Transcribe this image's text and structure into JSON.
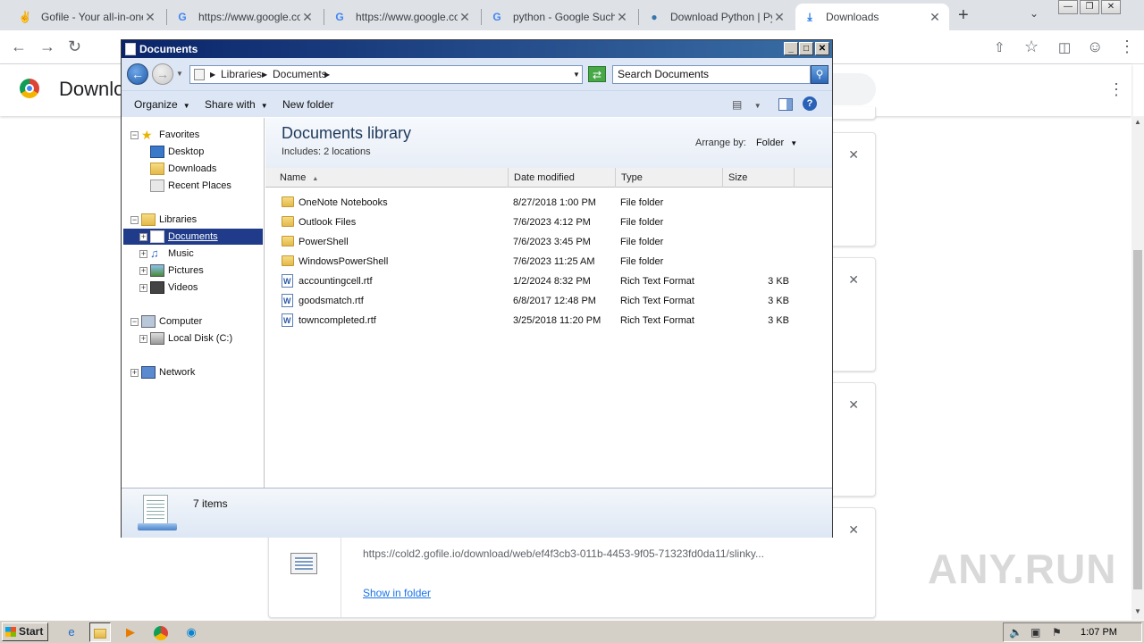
{
  "browser": {
    "tabs": [
      {
        "title": "Gofile - Your all-in-one",
        "icon": "gofile-icon"
      },
      {
        "title": "https://www.google.co",
        "icon": "google-icon"
      },
      {
        "title": "https://www.google.co",
        "icon": "google-icon"
      },
      {
        "title": "python - Google Suche",
        "icon": "google-icon"
      },
      {
        "title": "Download Python | Pyt",
        "icon": "python-icon"
      },
      {
        "title": "Downloads",
        "icon": "download-icon",
        "active": true
      }
    ]
  },
  "downloads_page": {
    "title": "Downloads",
    "card": {
      "url": "https://cold2.gofile.io/download/web/ef4f3cb3-011b-4453-9f05-71323fd0da11/slinky...",
      "show_in_folder": "Show in folder"
    }
  },
  "explorer": {
    "title": "Documents",
    "address": {
      "segments": [
        "Libraries",
        "Documents"
      ]
    },
    "search_placeholder": "Search Documents",
    "commands": {
      "organize": "Organize",
      "share_with": "Share with",
      "new_folder": "New folder"
    },
    "nav": {
      "favorites": "Favorites",
      "desktop": "Desktop",
      "downloads": "Downloads",
      "recent_places": "Recent Places",
      "libraries": "Libraries",
      "documents": "Documents",
      "music": "Music",
      "pictures": "Pictures",
      "videos": "Videos",
      "computer": "Computer",
      "local_disk": "Local Disk (C:)",
      "network": "Network"
    },
    "library": {
      "title": "Documents library",
      "includes": "Includes:  2 locations",
      "arrange_by_label": "Arrange by:",
      "arrange_by_value": "Folder"
    },
    "columns": {
      "name": "Name",
      "date": "Date modified",
      "type": "Type",
      "size": "Size"
    },
    "files": [
      {
        "name": "OneNote Notebooks",
        "date": "8/27/2018 1:00 PM",
        "type": "File folder",
        "size": "",
        "kind": "folder"
      },
      {
        "name": "Outlook Files",
        "date": "7/6/2023 4:12 PM",
        "type": "File folder",
        "size": "",
        "kind": "folder"
      },
      {
        "name": "PowerShell",
        "date": "7/6/2023 3:45 PM",
        "type": "File folder",
        "size": "",
        "kind": "folder"
      },
      {
        "name": "WindowsPowerShell",
        "date": "7/6/2023 11:25 AM",
        "type": "File folder",
        "size": "",
        "kind": "folder"
      },
      {
        "name": "accountingcell.rtf",
        "date": "1/2/2024 8:32 PM",
        "type": "Rich Text Format",
        "size": "3 KB",
        "kind": "rtf"
      },
      {
        "name": "goodsmatch.rtf",
        "date": "6/8/2017 12:48 PM",
        "type": "Rich Text Format",
        "size": "3 KB",
        "kind": "rtf"
      },
      {
        "name": "towncompleted.rtf",
        "date": "3/25/2018 11:20 PM",
        "type": "Rich Text Format",
        "size": "3 KB",
        "kind": "rtf"
      }
    ],
    "status": "7 items"
  },
  "taskbar": {
    "start_label": "Start",
    "clock": "1:07 PM"
  },
  "watermark": "ANY.RUN"
}
